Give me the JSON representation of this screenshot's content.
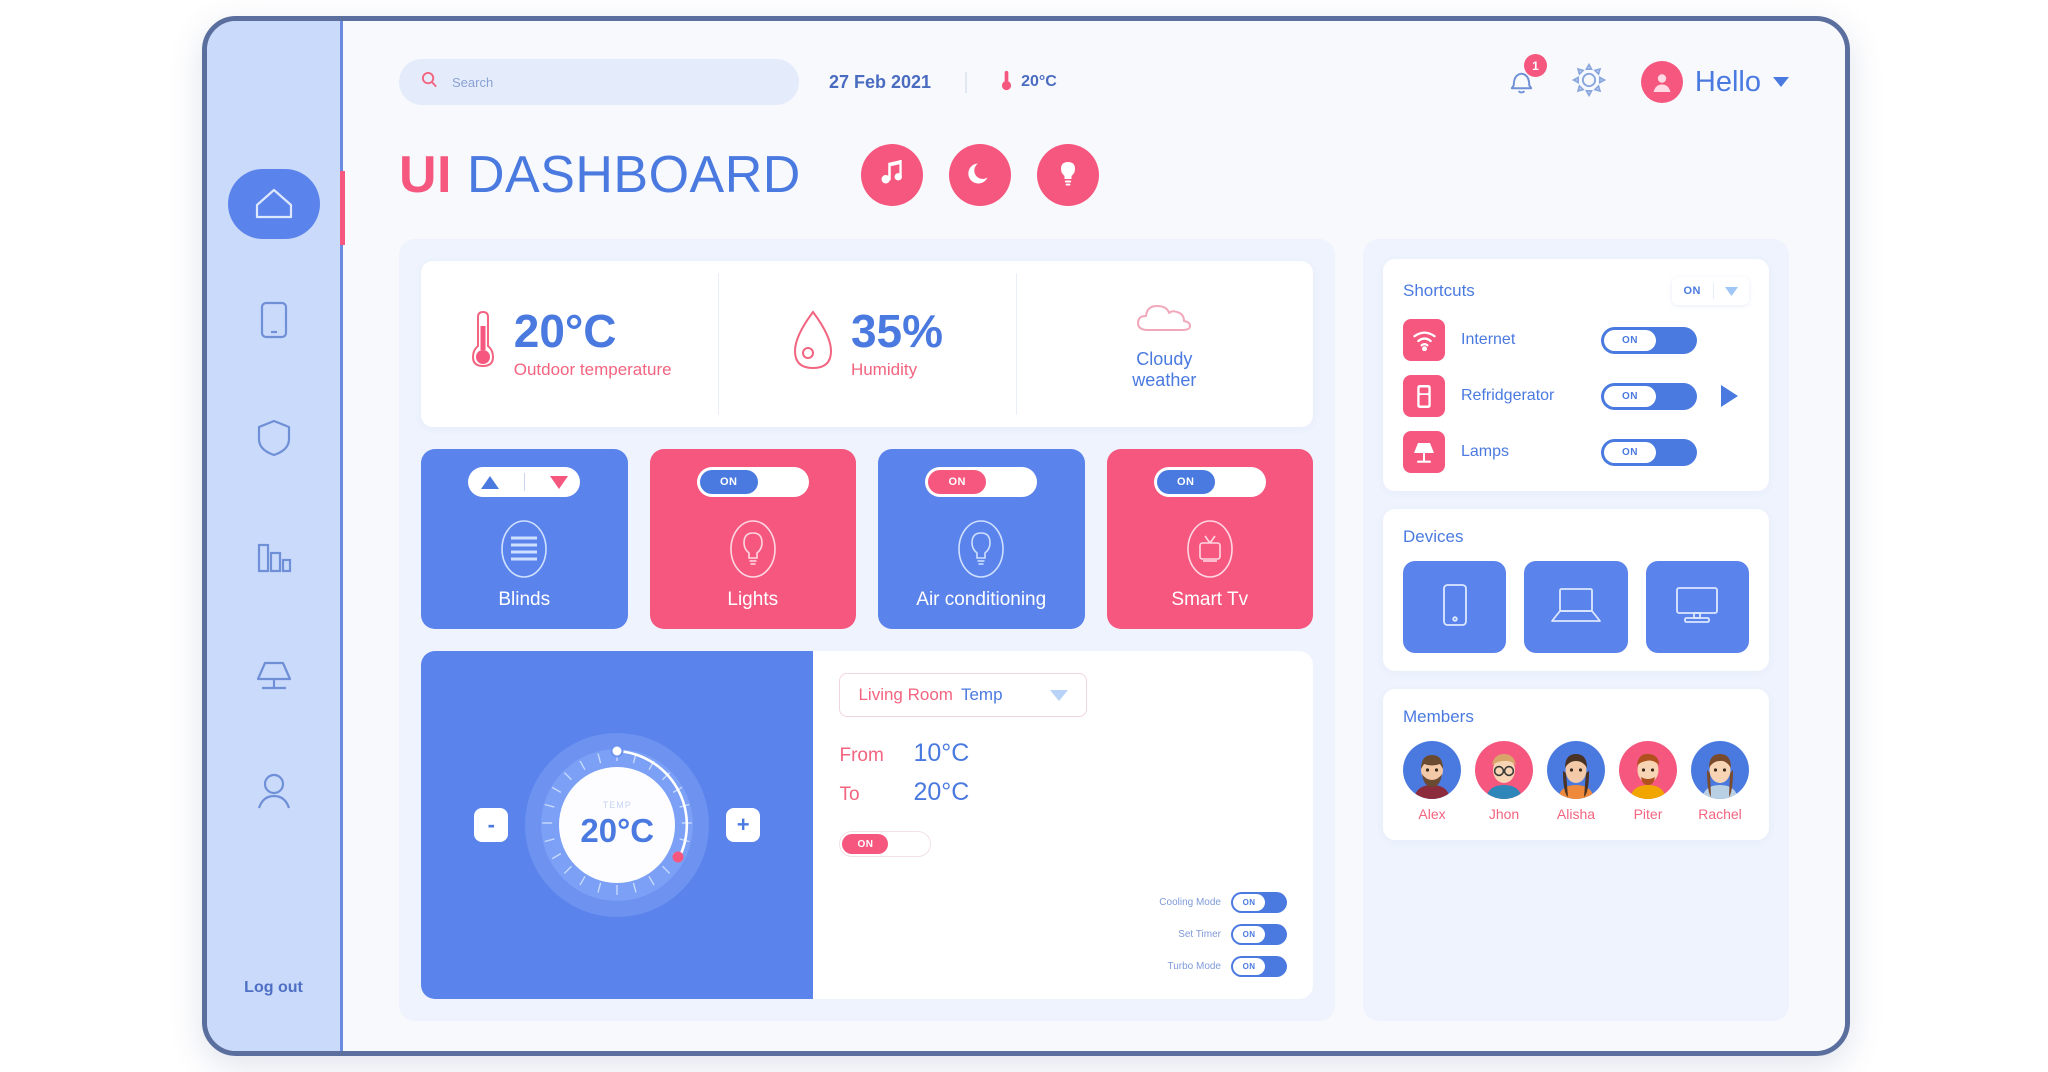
{
  "app": {
    "title_accent": "UI",
    "title_main": "DASHBOARD"
  },
  "sidebar": {
    "items": [
      {
        "label": "Home",
        "icon": "home-icon",
        "active": true
      },
      {
        "label": "Devices",
        "icon": "tablet-icon",
        "active": false
      },
      {
        "label": "Security",
        "icon": "shield-icon",
        "active": false
      },
      {
        "label": "Statistics",
        "icon": "bar-chart-icon",
        "active": false
      },
      {
        "label": "Lighting",
        "icon": "lamp-icon",
        "active": false
      },
      {
        "label": "Profile",
        "icon": "user-icon",
        "active": false
      }
    ],
    "logout_label": "Log out"
  },
  "topbar": {
    "search_placeholder": "Search",
    "search_value": "",
    "search_icon": "search-icon",
    "date": "27 Feb 2021",
    "temperature": "20°C",
    "thermometer_icon": "thermometer-icon",
    "notification_icon": "bell-icon",
    "notification_count": "1",
    "settings_icon": "gear-icon",
    "user_greeting": "Hello",
    "user_avatar_icon": "user-avatar-icon",
    "dropdown_icon": "chevron-down-icon"
  },
  "quick_actions": [
    {
      "name": "music",
      "icon": "music-note-icon"
    },
    {
      "name": "night",
      "icon": "moon-icon"
    },
    {
      "name": "light",
      "icon": "bulb-icon"
    }
  ],
  "weather": [
    {
      "icon": "thermometer-icon",
      "value": "20°C",
      "label": "Outdoor temperature"
    },
    {
      "icon": "droplet-icon",
      "value": "35%",
      "label": "Humidity"
    },
    {
      "icon": "cloud-icon",
      "label_line1": "Cloudy",
      "label_line2": "weather"
    }
  ],
  "device_cards": [
    {
      "label": "Blinds",
      "card_color": "blue",
      "icon": "blinds-icon",
      "control": "updown",
      "up_icon": "triangle-up-icon",
      "down_icon": "triangle-down-icon"
    },
    {
      "label": "Lights",
      "card_color": "pink",
      "icon": "bulb-outline-icon",
      "control": "toggle",
      "toggle_state": "ON",
      "knob_color": "blue"
    },
    {
      "label": "Air conditioning",
      "card_color": "blue",
      "icon": "bulb-outline-icon",
      "control": "toggle",
      "toggle_state": "ON",
      "knob_color": "pink"
    },
    {
      "label": "Smart Tv",
      "card_color": "pink",
      "icon": "tv-icon",
      "control": "toggle",
      "toggle_state": "ON",
      "knob_color": "blue"
    }
  ],
  "thermostat": {
    "dial_value": "20°C",
    "dial_caption": "TEMP",
    "minus_label": "-",
    "plus_label": "+",
    "room_name_accent": "Living Room",
    "room_name_main": "Temp",
    "room_dropdown_icon": "chevron-down-icon",
    "from_label": "From",
    "from_value": "10°C",
    "to_label": "To",
    "to_value": "20°C",
    "power_toggle_state": "ON",
    "modes": [
      {
        "label": "Cooling Mode",
        "state": "ON"
      },
      {
        "label": "Set Timer",
        "state": "ON"
      },
      {
        "label": "Turbo Mode",
        "state": "ON"
      }
    ]
  },
  "shortcuts": {
    "title": "Shortcuts",
    "header_state": "ON",
    "header_dropdown_icon": "chevron-down-icon",
    "play_icon": "play-icon",
    "items": [
      {
        "name": "Internet",
        "icon": "wifi-icon",
        "state": "ON"
      },
      {
        "name": "Refridgerator",
        "icon": "fridge-icon",
        "state": "ON"
      },
      {
        "name": "Lamps",
        "icon": "lamp-icon",
        "state": "ON"
      }
    ]
  },
  "devices": {
    "title": "Devices",
    "items": [
      {
        "name": "Tablet",
        "icon": "tablet-icon"
      },
      {
        "name": "Laptop",
        "icon": "laptop-icon"
      },
      {
        "name": "Monitor",
        "icon": "monitor-icon"
      }
    ]
  },
  "members": {
    "title": "Members",
    "items": [
      {
        "name": "Alex",
        "avatar_color": "blue"
      },
      {
        "name": "Jhon",
        "avatar_color": "pink"
      },
      {
        "name": "Alisha",
        "avatar_color": "blue"
      },
      {
        "name": "Piter",
        "avatar_color": "pink"
      },
      {
        "name": "Rachel",
        "avatar_color": "blue"
      }
    ]
  },
  "colors": {
    "accent_pink": "#f5577f",
    "accent_blue": "#4a7ae0",
    "card_blue": "#5b83ec",
    "panel_bg": "#eef3fd",
    "sidebar_bg": "#c9dafb",
    "frame_border": "#5b6f9e"
  }
}
